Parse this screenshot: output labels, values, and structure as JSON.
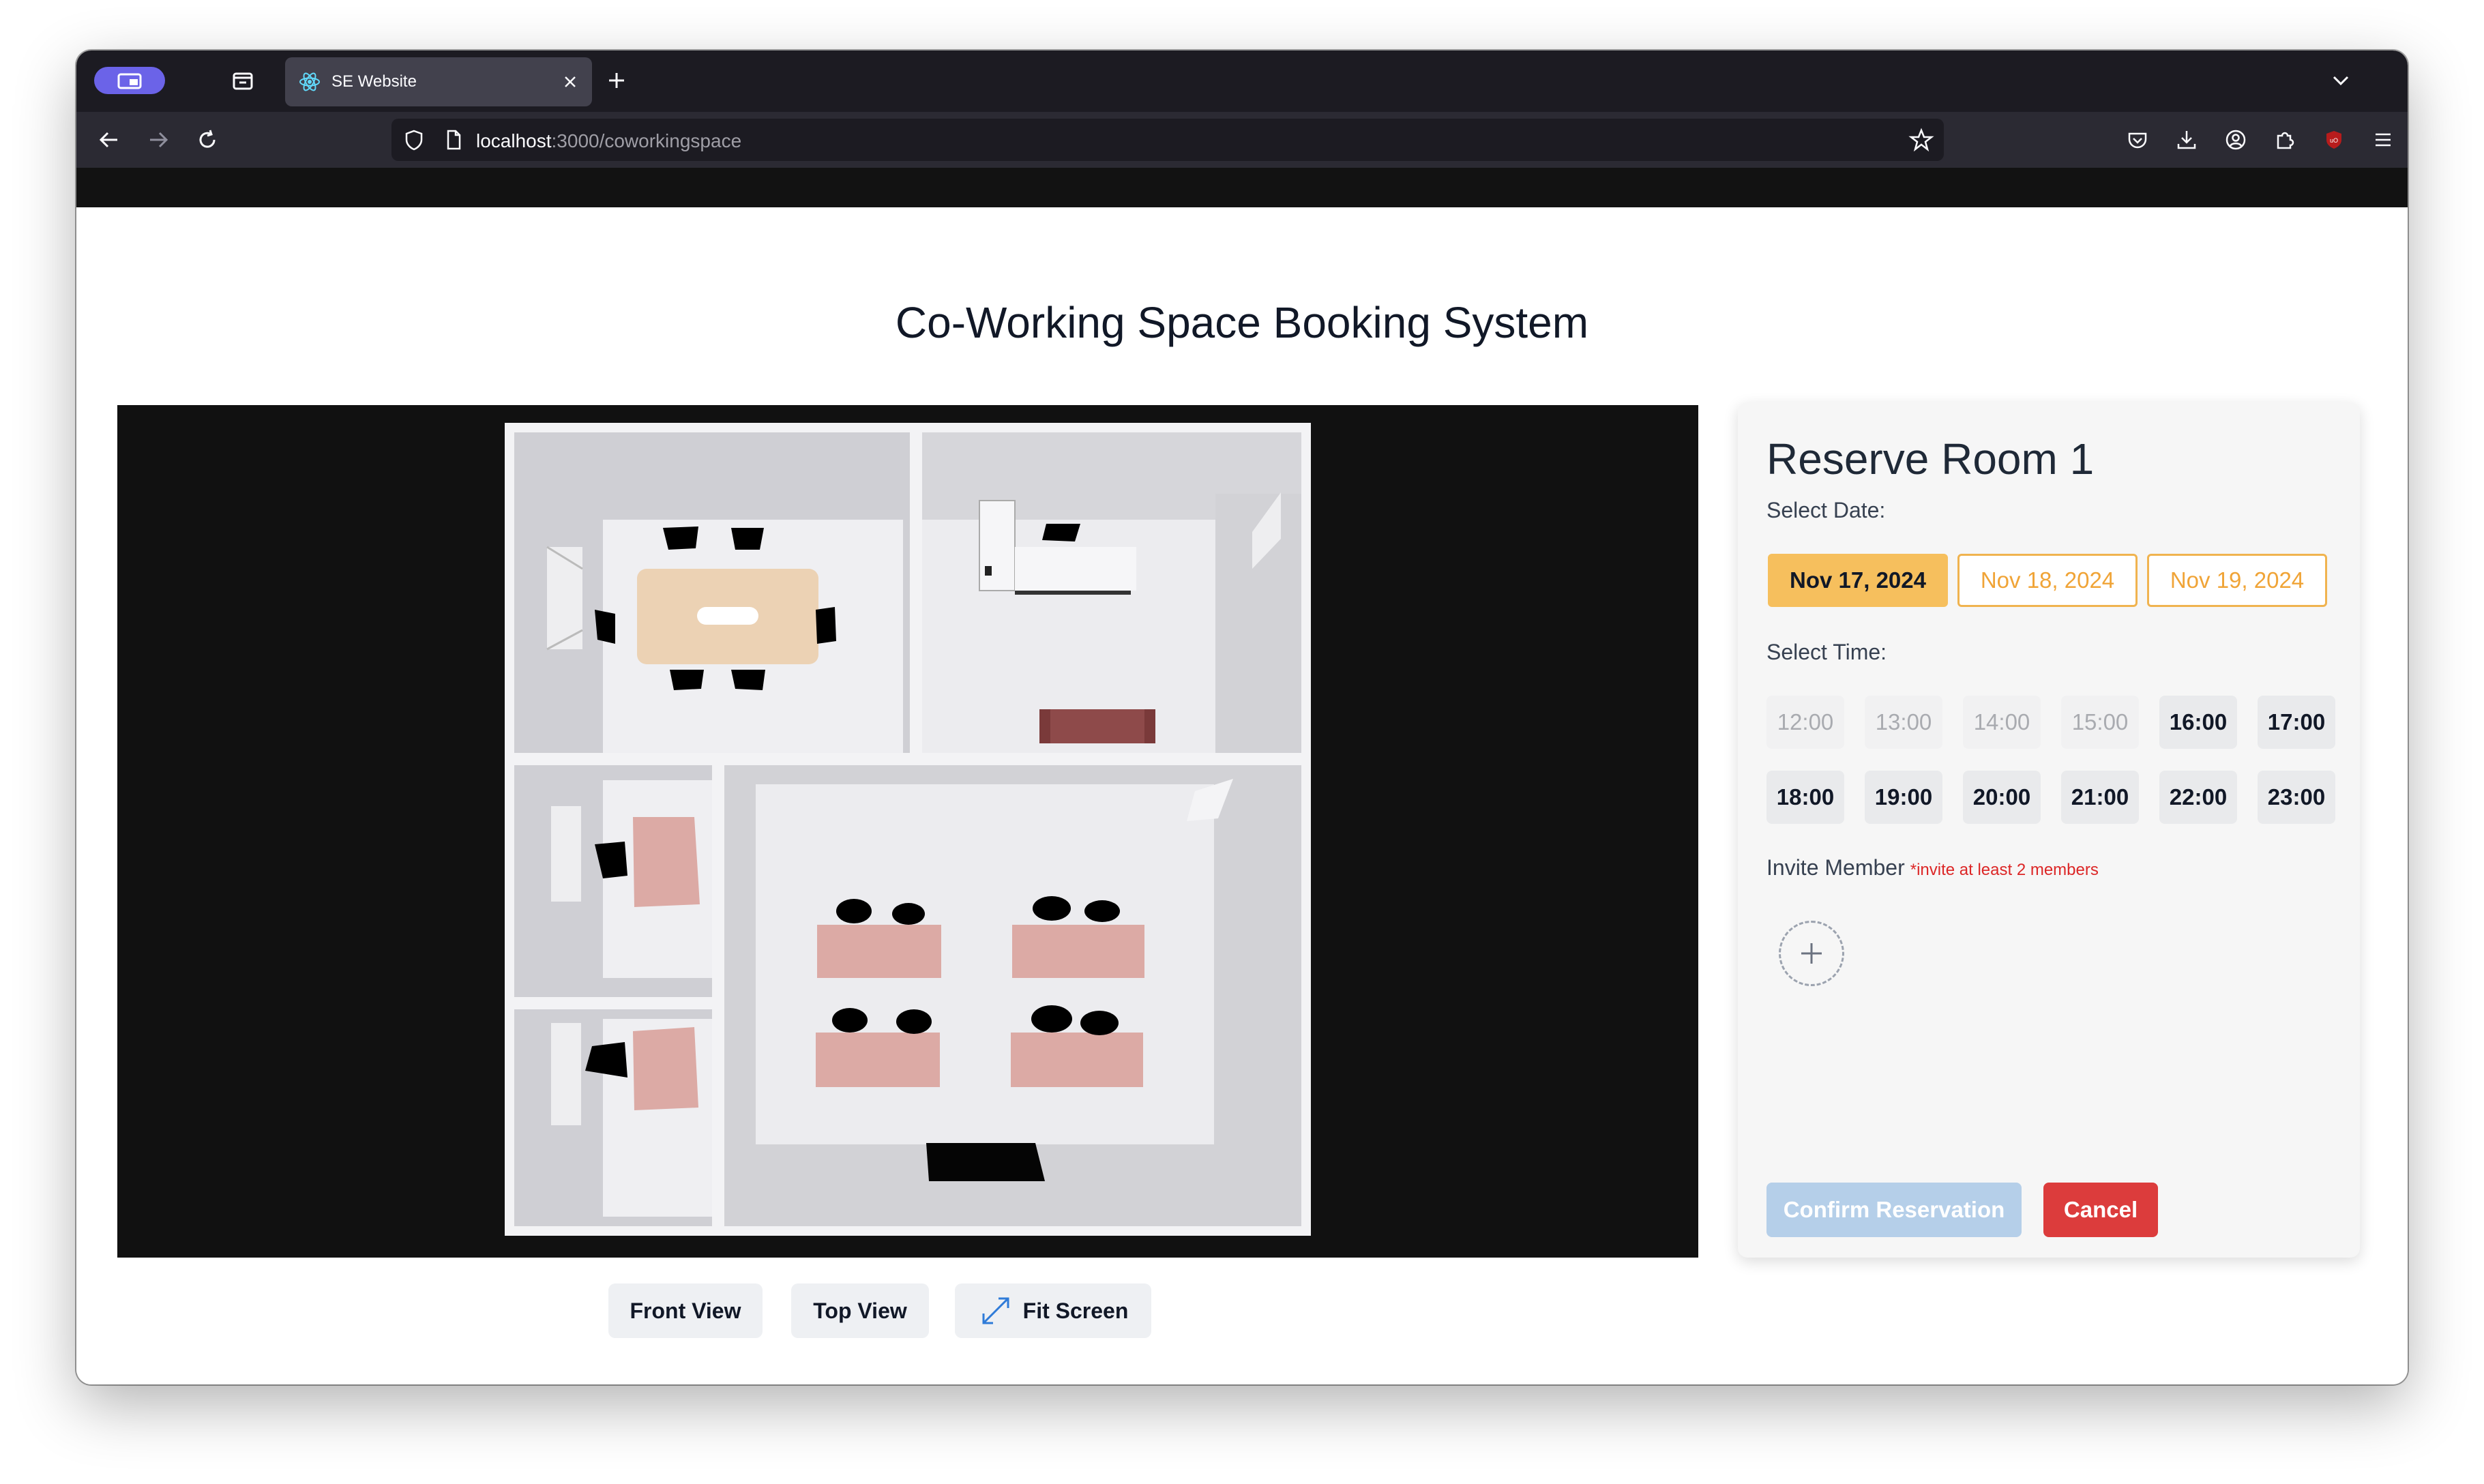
{
  "browser": {
    "tab_title": "SE Website",
    "url_host": "localhost",
    "url_path": ":3000/coworkingspace",
    "icons": [
      "profile-icon",
      "tab-overview-icon",
      "react-icon",
      "close-icon",
      "new-tab-icon",
      "chevron-down-icon",
      "back-icon",
      "forward-icon",
      "reload-icon",
      "shield-icon",
      "page-icon",
      "star-icon",
      "pocket-icon",
      "download-icon",
      "account-icon",
      "extensions-icon",
      "ublock-icon",
      "menu-icon"
    ]
  },
  "page": {
    "title": "Co-Working Space Booking System"
  },
  "viewer": {
    "buttons": {
      "front_view": "Front View",
      "top_view": "Top View",
      "fit_screen": "Fit Screen"
    },
    "colors": {
      "background": "#111111",
      "floor": "#eaeaec",
      "wall": "#d6d6da",
      "desk": "#dcaaa5",
      "meeting_table": "#ecd2b4",
      "sofa": "#8e4a4a",
      "chair": "#000000"
    }
  },
  "reservation": {
    "title": "Reserve Room 1",
    "select_date_label": "Select Date:",
    "dates": [
      {
        "label": "Nov 17, 2024",
        "selected": true
      },
      {
        "label": "Nov 18, 2024",
        "selected": false
      },
      {
        "label": "Nov 19, 2024",
        "selected": false
      }
    ],
    "select_time_label": "Select Time:",
    "times": [
      {
        "label": "12:00",
        "available": false
      },
      {
        "label": "13:00",
        "available": false
      },
      {
        "label": "14:00",
        "available": false
      },
      {
        "label": "15:00",
        "available": false
      },
      {
        "label": "16:00",
        "available": true
      },
      {
        "label": "17:00",
        "available": true
      },
      {
        "label": "18:00",
        "available": true
      },
      {
        "label": "19:00",
        "available": true
      },
      {
        "label": "20:00",
        "available": true
      },
      {
        "label": "21:00",
        "available": true
      },
      {
        "label": "22:00",
        "available": true
      },
      {
        "label": "23:00",
        "available": true
      }
    ],
    "invite_label": "Invite Member",
    "invite_note": "*invite at least 2 members",
    "confirm_label": "Confirm Reservation",
    "cancel_label": "Cancel",
    "colors": {
      "accent": "#f6bf5d",
      "confirm_disabled": "#b5cfe9",
      "cancel": "#dc3c3c",
      "note": "#dc2626"
    }
  }
}
